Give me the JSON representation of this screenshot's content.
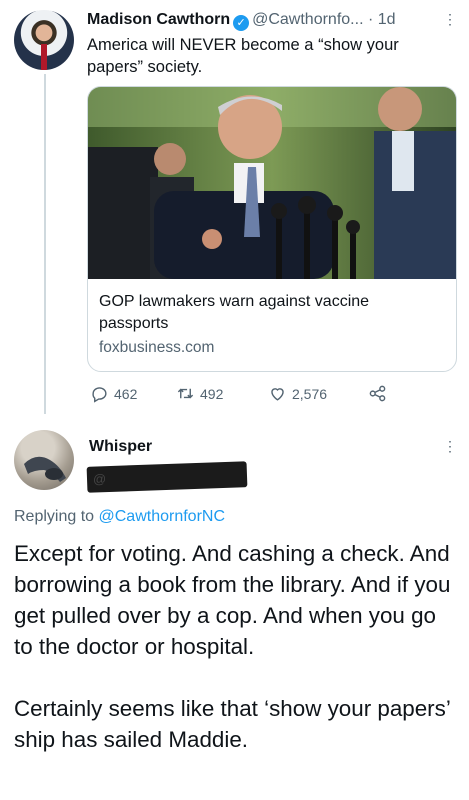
{
  "tweet": {
    "author_name": "Madison Cawthorn",
    "handle": "@Cawthornfo...",
    "separator": "·",
    "time": "1d",
    "text": "America will NEVER become a “show your papers” society.",
    "more_icon": "vertical-dots-icon",
    "verified_icon": "verified-badge-icon",
    "card": {
      "title": "GOP lawmakers warn against vaccine passports",
      "domain": "foxbusiness.com"
    },
    "actions": {
      "replies": "462",
      "retweets": "492",
      "likes": "2,576"
    }
  },
  "reply": {
    "author_name": "Whisper",
    "handle": "@",
    "replying_prefix": "Replying to",
    "replying_to": "@CawthornforNC",
    "more_icon": "vertical-dots-icon",
    "paragraphs": [
      "Except for voting.  And cashing a check.  And borrowing a book from the library.  And if you get pulled over by a cop.  And when you go to the doctor or hospital.",
      "Certainly seems like that ‘show your papers’ ship has sailed Maddie."
    ]
  },
  "colors": {
    "link": "#1d9bf0",
    "muted": "#536471",
    "border": "#cfd9de"
  }
}
